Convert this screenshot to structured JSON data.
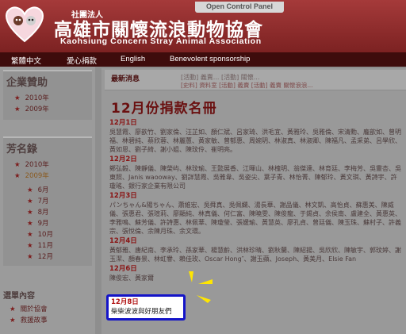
{
  "header": {
    "open_panel": "Open Control Panel",
    "org_prefix": "社團法人",
    "org_title": "高雄市關懷流浪動物協會",
    "org_en": "Kaohsiung Concern Stray Animal Association"
  },
  "nav": {
    "items": [
      "繁體中文",
      "愛心捐款",
      "English",
      "Benevolent sponsorship"
    ]
  },
  "sidebar": {
    "sponsor": {
      "title": "企業贊助",
      "items": [
        "2010年",
        "2009年"
      ]
    },
    "donors": {
      "title": "芳名錄",
      "years": [
        "2010年",
        "2009年"
      ],
      "months": [
        "6月",
        "7月",
        "8月",
        "9月",
        "10月",
        "11月",
        "12月"
      ]
    },
    "selected": {
      "title": "選單內容",
      "items": [
        "關於協會",
        "救援故事"
      ]
    }
  },
  "news": {
    "label": "最新消息",
    "scroll": "[活動] 義賣... [活動] 關懷...",
    "sub": "[史料] 資料室   [活動] 義賣   [活動] 義賣 關懷浪浪..."
  },
  "main": {
    "title": "12月份捐款名冊",
    "entries": [
      {
        "date": "12月1日",
        "text": "吳慧霞、廖歆竹、劉家倫、汪芷如、顏仁斌、呂家琦、洪毛宜、黃雅玲、吳雅倫、宋清勳、龐歆如、曾明福、林碧純、蔡欣蓉、林麗蕙、黃家敏、曾郁惠、周婉玥、林淑真、林淑卿、陳福凡、孟采弟、呂學欣、黃如恩、劉子綺、謝小姐、陳玟伶、崔明亮。"
      },
      {
        "date": "12月2日",
        "text": "鄭弘毅、陳靜儀、陳榮屿、林玟瑜、王懿展香、江暉山、林槐明、翁傑達、林育廷、李梅芳、吳靈杏、吳東照、Janis waooway、劉詳慧霞、吳雅韋、吳姿尖、葉子青、林怡菁、陳郁玲、黃文琪、黃詩宇、許瓊瑤、銀行家企業有限公司"
      },
      {
        "date": "12月3日",
        "text": "パンちゃん&陽ちゃん、蕭維宏、吳舜真、吳佩嫻、湯長華、謝品儀、林文凱、高怡貞、蘇惠美、陳威儀、張惠君、張瑄莉、廖顯純、林真儀、何仁富、陳曉雯、陳俊龍、于錫貞、余侯南、盧建全、黃惠英、李雅鳴、蘇芳儀、許詩惠、林佩華、陳瓊瑩、張媛瑜、黃慧英、廖孔貞、曾廷儀、陳玉珠、蘇村子、許義宗、張悅倫、余陳月珠、余文環。"
      },
      {
        "date": "12月4日",
        "text": "黃郁雅、唐紀南、李承玲、孫家華、楊慧齡、洪林珍晴、劉秋蘭、陳紹揚、吳欣欣、陳敏宇、郭玟婷、謝玉潔、顏春景、林虹譽、賴佳玫、Oscar Hong″、謝玉蘋、Joseph、黃美月、Elsie Fan"
      },
      {
        "date": "12月6日",
        "text": "陳俊宏、黃家爾"
      }
    ],
    "highlight": {
      "date": "12月8日",
      "text": "柴柴波波與好朋友們"
    }
  },
  "colors": {
    "header_red": "#8f2c2c",
    "nav_dark": "#3e0c0c",
    "title_red": "#6a1010",
    "highlight_border": "#1414c8",
    "spark_yellow": "#ffe600"
  }
}
